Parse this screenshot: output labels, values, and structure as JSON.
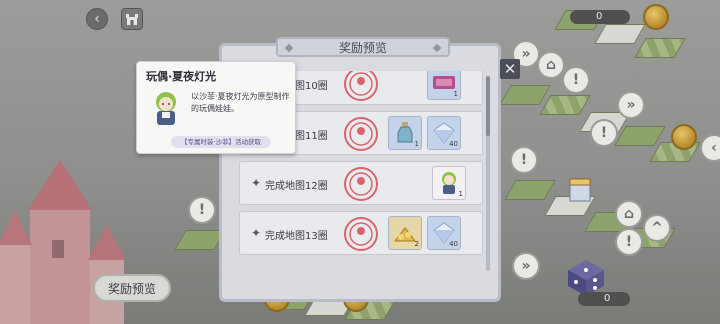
{
  "topbar": {
    "back_icon": "chevron-left-icon",
    "home_icon": "castle-icon"
  },
  "currency": {
    "top_value": "0",
    "bottom_value": "0"
  },
  "preview_button_label": "奖励预览",
  "dialog": {
    "title": "奖励预览",
    "rows": [
      {
        "label": "完成地图10圈",
        "items": [
          {
            "icon": "ticket-icon",
            "qty": "1"
          }
        ]
      },
      {
        "label": "完成地图11圈",
        "items": [
          {
            "icon": "potion-icon",
            "qty": "1"
          },
          {
            "icon": "diamond-icon",
            "qty": "40"
          }
        ]
      },
      {
        "label": "完成地图12圈",
        "items": [
          {
            "icon": "doll-icon",
            "qty": "1"
          }
        ]
      },
      {
        "label": "完成地图13圈",
        "items": [
          {
            "icon": "gold-pile-icon",
            "qty": "2"
          },
          {
            "icon": "diamond-icon",
            "qty": "40"
          }
        ]
      }
    ]
  },
  "tooltip": {
    "title": "玩偶·夏夜灯光",
    "desc": "以沙菲·夏夜灯光为原型制作的玩偶娃娃。",
    "tag": "【专属时装·沙菲】活动获取"
  },
  "colors": {
    "dialog_bg": "#d9dbe1",
    "row_bg": "#e9eaee",
    "stamp_red": "#d8646e",
    "diamond": "#b9c9ea"
  }
}
